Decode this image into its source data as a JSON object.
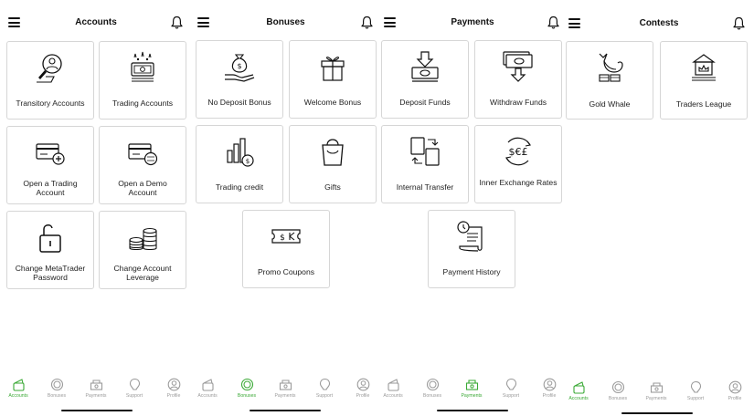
{
  "tabbar_labels": [
    "Accounts",
    "Bonuses",
    "Payments",
    "Support",
    "Profile"
  ],
  "accent_color": "#3aa935",
  "screens": [
    {
      "title": "Accounts",
      "active_tab": "Accounts",
      "cards": [
        {
          "label": "Transitory Accounts",
          "icon": "magnifier-person-icon"
        },
        {
          "label": "Trading Accounts",
          "icon": "money-stack-icon"
        },
        {
          "label": "Open a Trading Account",
          "icon": "add-card-icon"
        },
        {
          "label": "Open a Demo Account",
          "icon": "demo-card-icon"
        },
        {
          "label": "Change MetaTrader Password",
          "icon": "unlock-icon"
        },
        {
          "label": "Change Account Leverage",
          "icon": "coin-stacks-icon"
        }
      ]
    },
    {
      "title": "Bonuses",
      "active_tab": "Bonuses",
      "cards": [
        {
          "label": "No Deposit Bonus",
          "icon": "money-hand-icon"
        },
        {
          "label": "Welcome Bonus",
          "icon": "gift-box-icon"
        },
        {
          "label": "Trading credit",
          "icon": "bar-chart-coin-icon"
        },
        {
          "label": "Gifts",
          "icon": "shopping-bag-icon"
        },
        {
          "label": "Promo Coupons",
          "icon": "coupon-icon"
        }
      ]
    },
    {
      "title": "Payments",
      "active_tab": "Payments",
      "cards": [
        {
          "label": "Deposit Funds",
          "icon": "deposit-icon"
        },
        {
          "label": "Withdraw Funds",
          "icon": "withdraw-icon"
        },
        {
          "label": "Internal Transfer",
          "icon": "transfer-icon"
        },
        {
          "label": "Inner Exchange Rates",
          "icon": "currency-exchange-icon"
        },
        {
          "label": "Payment History",
          "icon": "scroll-history-icon"
        }
      ]
    },
    {
      "title": "Contests",
      "active_tab": "Accounts",
      "cards": [
        {
          "label": "Gold Whale",
          "icon": "whale-icon"
        },
        {
          "label": "Traders League",
          "icon": "league-trophy-icon"
        }
      ]
    }
  ]
}
